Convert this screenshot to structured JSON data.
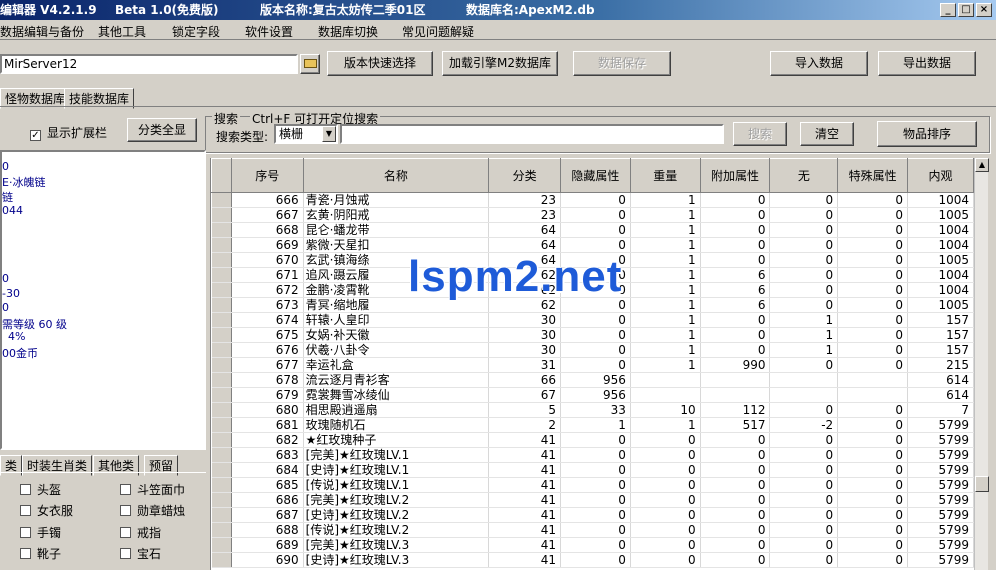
{
  "title": {
    "app": "编辑器 V4.2.1.9",
    "beta": "Beta 1.0(免费版)",
    "version": "版本名称:复古太妨传二季01区",
    "db": "数据库名:ApexM2.db"
  },
  "window_buttons": [
    "_",
    "□",
    "×"
  ],
  "menu": [
    "数据编辑与备份",
    "其他工具",
    "锁定字段",
    "软件设置",
    "数据库切换",
    "常见问题解疑"
  ],
  "server": {
    "value": "MirServer12"
  },
  "toolbar": {
    "version_select": "版本快速选择",
    "load_db": "加载引擎M2数据库",
    "save_data": "数据保存",
    "import": "导入数据",
    "export": "导出数据"
  },
  "tabs": [
    "怪物数据库",
    "技能数据库"
  ],
  "show_ext": "显示扩展栏",
  "show_all": "分类全显",
  "search": {
    "group_label": "搜索",
    "hint": "Ctrl+F 可打开定位搜索",
    "type_label": "搜索类型:",
    "type_value": "横栅",
    "button": "搜索",
    "clear": "清空",
    "sort": "物品排序"
  },
  "left_list": [
    "0",
    "E·冰魄链",
    "链",
    "044",
    "",
    "",
    "0",
    "-30",
    "0",
    "需等级 60 级",
    "4%",
    "00金币"
  ],
  "category_tabs": [
    "类",
    "时装生肖类",
    "其他类",
    "预留"
  ],
  "checkboxes": [
    "头盔",
    "斗笠面巾",
    "女衣服",
    "勋章蜡烛",
    "手镯",
    "戒指",
    "靴子",
    "宝石"
  ],
  "columns": [
    "序号",
    "名称",
    "分类",
    "隐藏属性",
    "重量",
    "附加属性",
    "无",
    "特殊属性",
    "内观"
  ],
  "rows": [
    [
      "666",
      "青瓷·月蚀戒",
      "23",
      "0",
      "1",
      "0",
      "0",
      "0",
      "1004"
    ],
    [
      "667",
      "玄黄·阴阳戒",
      "23",
      "0",
      "1",
      "0",
      "0",
      "0",
      "1005"
    ],
    [
      "668",
      "昆仑·蟠龙带",
      "64",
      "0",
      "1",
      "0",
      "0",
      "0",
      "1004"
    ],
    [
      "669",
      "紫微·天星扣",
      "64",
      "0",
      "1",
      "0",
      "0",
      "0",
      "1004"
    ],
    [
      "670",
      "玄武·镇海绦",
      "64",
      "0",
      "1",
      "0",
      "0",
      "0",
      "1005"
    ],
    [
      "671",
      "追风·蹑云履",
      "62",
      "0",
      "1",
      "6",
      "0",
      "0",
      "1004"
    ],
    [
      "672",
      "金鹏·凌霄靴",
      "62",
      "0",
      "1",
      "6",
      "0",
      "0",
      "1004"
    ],
    [
      "673",
      "青冥·缩地履",
      "62",
      "0",
      "1",
      "6",
      "0",
      "0",
      "1005"
    ],
    [
      "674",
      "轩辕·人皇印",
      "30",
      "0",
      "1",
      "0",
      "1",
      "0",
      "157"
    ],
    [
      "675",
      "女娲·补天徽",
      "30",
      "0",
      "1",
      "0",
      "1",
      "0",
      "157"
    ],
    [
      "676",
      "伏羲·八卦令",
      "30",
      "0",
      "1",
      "0",
      "1",
      "0",
      "157"
    ],
    [
      "677",
      "幸运礼盒",
      "31",
      "0",
      "1",
      "990",
      "0",
      "0",
      "215"
    ],
    [
      "678",
      "流云逐月青衫客",
      "66",
      "956",
      "",
      "",
      "",
      "",
      "614"
    ],
    [
      "679",
      "霓裳舞雪冰绫仙",
      "67",
      "956",
      "",
      "",
      "",
      "",
      "614"
    ],
    [
      "680",
      "相思殿逍遥扇",
      "5",
      "33",
      "10",
      "112",
      "0",
      "0",
      "7"
    ],
    [
      "681",
      "玫瑰随机石",
      "2",
      "1",
      "1",
      "517",
      "-2",
      "0",
      "5799"
    ],
    [
      "682",
      "★红玫瑰种子",
      "41",
      "0",
      "0",
      "0",
      "0",
      "0",
      "5799"
    ],
    [
      "683",
      "[完美]★红玫瑰LV.1",
      "41",
      "0",
      "0",
      "0",
      "0",
      "0",
      "5799"
    ],
    [
      "684",
      "[史诗]★红玫瑰LV.1",
      "41",
      "0",
      "0",
      "0",
      "0",
      "0",
      "5799"
    ],
    [
      "685",
      "[传说]★红玫瑰LV.1",
      "41",
      "0",
      "0",
      "0",
      "0",
      "0",
      "5799"
    ],
    [
      "686",
      "[完美]★红玫瑰LV.2",
      "41",
      "0",
      "0",
      "0",
      "0",
      "0",
      "5799"
    ],
    [
      "687",
      "[史诗]★红玫瑰LV.2",
      "41",
      "0",
      "0",
      "0",
      "0",
      "0",
      "5799"
    ],
    [
      "688",
      "[传说]★红玫瑰LV.2",
      "41",
      "0",
      "0",
      "0",
      "0",
      "0",
      "5799"
    ],
    [
      "689",
      "[完美]★红玫瑰LV.3",
      "41",
      "0",
      "0",
      "0",
      "0",
      "0",
      "5799"
    ],
    [
      "690",
      "[史诗]★红玫瑰LV.3",
      "41",
      "0",
      "0",
      "0",
      "0",
      "0",
      "5799"
    ]
  ],
  "watermark": "lspm2.net"
}
